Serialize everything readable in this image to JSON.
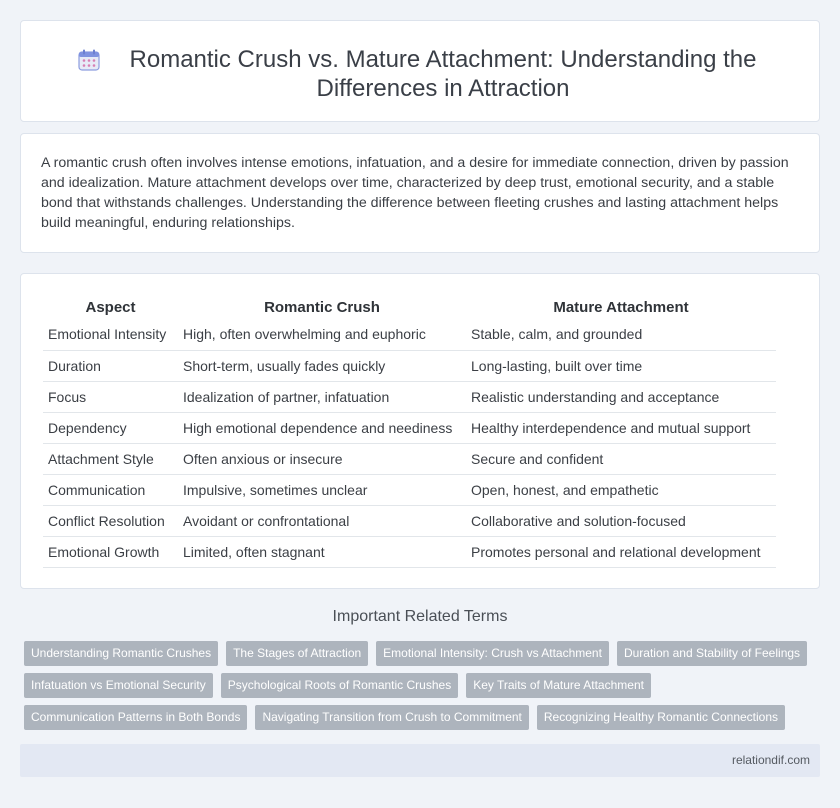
{
  "header": {
    "title": "Romantic Crush vs. Mature Attachment: Understanding the Differences in Attraction",
    "icon": "calendar-icon"
  },
  "intro": {
    "text": "A romantic crush often involves intense emotions, infatuation, and a desire for immediate connection, driven by passion and idealization. Mature attachment develops over time, characterized by deep trust, emotional security, and a stable bond that withstands challenges. Understanding the difference between fleeting crushes and lasting attachment helps build meaningful, enduring relationships."
  },
  "table": {
    "headers": [
      "Aspect",
      "Romantic Crush",
      "Mature Attachment"
    ],
    "rows": [
      [
        "Emotional Intensity",
        "High, often overwhelming and euphoric",
        "Stable, calm, and grounded"
      ],
      [
        "Duration",
        "Short-term, usually fades quickly",
        "Long-lasting, built over time"
      ],
      [
        "Focus",
        "Idealization of partner, infatuation",
        "Realistic understanding and acceptance"
      ],
      [
        "Dependency",
        "High emotional dependence and neediness",
        "Healthy interdependence and mutual support"
      ],
      [
        "Attachment Style",
        "Often anxious or insecure",
        "Secure and confident"
      ],
      [
        "Communication",
        "Impulsive, sometimes unclear",
        "Open, honest, and empathetic"
      ],
      [
        "Conflict Resolution",
        "Avoidant or confrontational",
        "Collaborative and solution-focused"
      ],
      [
        "Emotional Growth",
        "Limited, often stagnant",
        "Promotes personal and relational development"
      ]
    ]
  },
  "related": {
    "title": "Important Related Terms",
    "tags": [
      "Understanding Romantic Crushes",
      "The Stages of Attraction",
      "Emotional Intensity: Crush vs Attachment",
      "Duration and Stability of Feelings",
      "Infatuation vs Emotional Security",
      "Psychological Roots of Romantic Crushes",
      "Key Traits of Mature Attachment",
      "Communication Patterns in Both Bonds",
      "Navigating Transition from Crush to Commitment",
      "Recognizing Healthy Romantic Connections"
    ]
  },
  "footer": {
    "site": "relationdif.com"
  },
  "colors": {
    "background": "#f0f3f8",
    "tag_bg": "#adb4bd",
    "footer_bg": "#e3e8f3"
  }
}
